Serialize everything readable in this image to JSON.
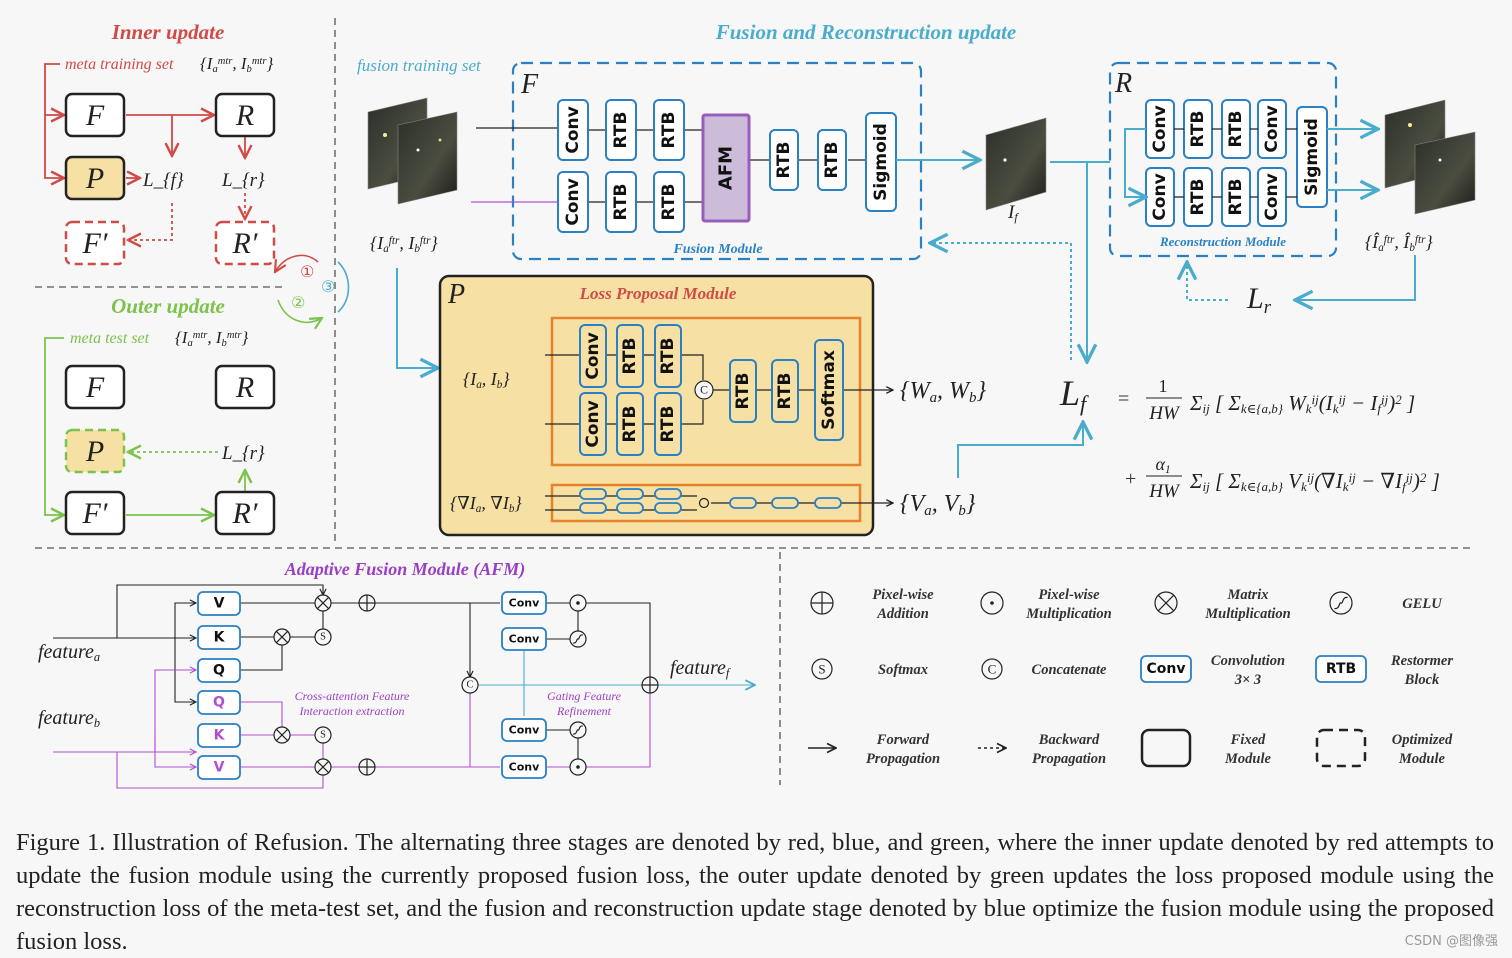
{
  "colors": {
    "red": "#cf4b48",
    "blue": "#4aaccc",
    "green": "#7dc24d",
    "purple": "#9a3fc4",
    "orange": "#e6822c",
    "yellow": "#f7e0a3",
    "block_border": "#2a80c4",
    "afm_fill": "#cdbcd9"
  },
  "inner": {
    "title": "Inner update",
    "set_label": "meta training set",
    "set_math": "{I_{a}^{mtr}, I_{b}^{mtr}}"
  },
  "outer": {
    "title": "Outer update",
    "set_label": "meta test set",
    "set_math": "{I_{a}^{mtr}, I_{b}^{mtr}}"
  },
  "symbols": {
    "F": "F",
    "R": "R",
    "P": "P",
    "F_prime": "F′",
    "R_prime": "R′",
    "Lf": "L_{f}",
    "Lr": "L_{r}"
  },
  "stage_markers": [
    "①",
    "②",
    "③"
  ],
  "fusion": {
    "title": "Fusion and Reconstruction update",
    "training_set": "fusion training set",
    "input_math": "{I_{a}^{ftr}, I_{b}^{ftr}}",
    "module_symbol": "F",
    "module_label": "Fusion Module",
    "top_row": [
      "Conv",
      "RTB",
      "RTB"
    ],
    "bottom_row": [
      "Conv",
      "RTB",
      "RTB"
    ],
    "afm": "AFM",
    "tail": [
      "RTB",
      "RTB",
      "Sigmoid"
    ],
    "output_math": "I_{f}"
  },
  "reconstruction": {
    "module_symbol": "R",
    "module_label": "Reconstruction Module",
    "top_row": [
      "Conv",
      "RTB",
      "RTB",
      "Conv"
    ],
    "bottom_row": [
      "Conv",
      "RTB",
      "RTB",
      "Conv"
    ],
    "sigmoid": "Sigmoid",
    "output_math": "{Î_{a}^{ftr}, Î_{b}^{ftr}}",
    "loss": "L_{r}"
  },
  "loss_proposal": {
    "symbol": "P",
    "title": "Loss Proposal Module",
    "input_math": "{I_{a}, I_{b}}",
    "grad_input_math": "{∇I_{a}, ∇I_{b}}",
    "top_row": [
      "Conv",
      "RTB",
      "RTB"
    ],
    "bottom_row": [
      "Conv",
      "RTB",
      "RTB"
    ],
    "concat": "C",
    "tail": [
      "RTB",
      "RTB",
      "Softmax"
    ],
    "weights_out": "{W_{a}, W_{b}}",
    "grad_out": "{V_{a}, V_{b}}"
  },
  "formula": {
    "lhs": "L_{f}",
    "line1_prefix": "=",
    "line1_frac_num": "1",
    "line1_frac_den": "HW",
    "line1_body": "Σ_{ij} [ Σ_{k∈{a,b}} W_{k}^{ij}(I_{k}^{ij} − I_{f}^{ij})^{2} ]",
    "line2_prefix": "+",
    "line2_frac_num": "α_{1}",
    "line2_frac_den": "HW",
    "line2_body": "Σ_{ij} [ Σ_{k∈{a,b}} V_{k}^{ij}(∇I_{k}^{ij} − ∇I_{f}^{ij})^{2} ]"
  },
  "afm": {
    "title": "Adaptive Fusion Module  (AFM)",
    "feature_a": "feature_{a}",
    "feature_b": "feature_{b}",
    "feature_f": "feature_{f}",
    "qkv_a": [
      "V",
      "K",
      "Q"
    ],
    "qkv_b": [
      "Q",
      "K",
      "V"
    ],
    "softmax": "S",
    "concat": "C",
    "conv": "Conv",
    "cross_attention_label": [
      "Cross-attention Feature",
      "Interaction extraction"
    ],
    "gating_label": [
      "Gating Feature",
      "Refinement"
    ]
  },
  "legend": [
    {
      "icon": "pixel-wise-addition-icon",
      "label": [
        "Pixel-wise",
        "Addition"
      ]
    },
    {
      "icon": "pixel-wise-multiplication-icon",
      "label": [
        "Pixel-wise",
        "Multiplication"
      ]
    },
    {
      "icon": "matrix-multiplication-icon",
      "label": [
        "Matrix",
        "Multiplication"
      ]
    },
    {
      "icon": "gelu-icon",
      "label": [
        "GELU",
        ""
      ]
    },
    {
      "icon": "softmax-icon",
      "glyph": "S",
      "label": [
        "Softmax",
        ""
      ]
    },
    {
      "icon": "concatenate-icon",
      "glyph": "C",
      "label": [
        "Concatenate",
        ""
      ]
    },
    {
      "icon": "conv-icon",
      "glyph": "Conv",
      "label": [
        "Convolution",
        "3× 3"
      ]
    },
    {
      "icon": "rtb-icon",
      "glyph": "RTB",
      "label": [
        "Restormer",
        "Block"
      ]
    },
    {
      "icon": "forward-arrow-icon",
      "label": [
        "Forward",
        "Propagation"
      ]
    },
    {
      "icon": "backward-arrow-icon",
      "label": [
        "Backward",
        "Propagation"
      ]
    },
    {
      "icon": "fixed-module-icon",
      "label": [
        "Fixed",
        "Module"
      ]
    },
    {
      "icon": "optimized-module-icon",
      "label": [
        "Optimized",
        "Module"
      ]
    }
  ],
  "caption": "Figure 1. Illustration of Refusion. The alternating three stages are denoted by red, blue, and green, where the inner update denoted by red attempts to update the fusion module using the currently proposed fusion loss, the outer update denoted by green updates the loss proposed module using the reconstruction loss of the meta-test set, and the fusion and reconstruction update stage denoted by blue optimize the fusion module using the proposed fusion loss.",
  "watermark": "CSDN @图像强"
}
